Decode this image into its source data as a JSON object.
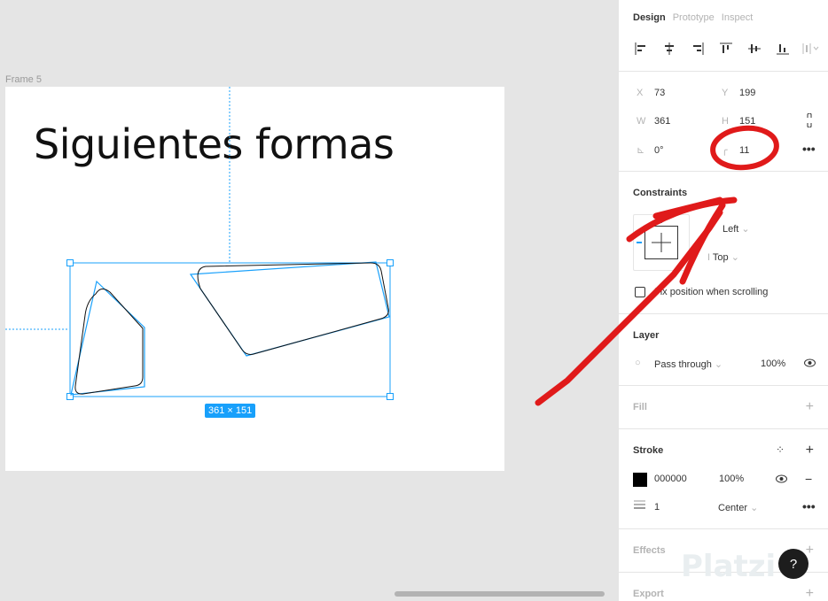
{
  "canvas": {
    "frame_label": "Frame 5",
    "frame_title": "Siguientes formas",
    "dimension_badge": "361 × 151"
  },
  "panel": {
    "tabs": [
      "Design",
      "Prototype",
      "Inspect"
    ],
    "active_tab": "Design",
    "position": {
      "x_label": "X",
      "x": "73",
      "y_label": "Y",
      "y": "199"
    },
    "size": {
      "w_label": "W",
      "w": "361",
      "h_label": "H",
      "h": "151"
    },
    "rotation": "0°",
    "corner_radius": "11",
    "constraints": {
      "title": "Constraints",
      "horizontal": "Left",
      "vertical": "Top",
      "fix_position_label": "Fix position when scrolling"
    },
    "layer": {
      "title": "Layer",
      "blend_mode": "Pass through",
      "opacity": "100%"
    },
    "fill": {
      "title": "Fill"
    },
    "stroke": {
      "title": "Stroke",
      "color_hex": "000000",
      "opacity": "100%",
      "weight": "1",
      "position": "Center"
    },
    "effects": {
      "title": "Effects"
    },
    "export": {
      "title": "Export"
    }
  },
  "watermark": "Platzi",
  "help_label": "?",
  "colors": {
    "selection_blue": "#18a0fb",
    "annotation_red": "#e01a1a",
    "canvas_bg": "#e5e5e5"
  }
}
